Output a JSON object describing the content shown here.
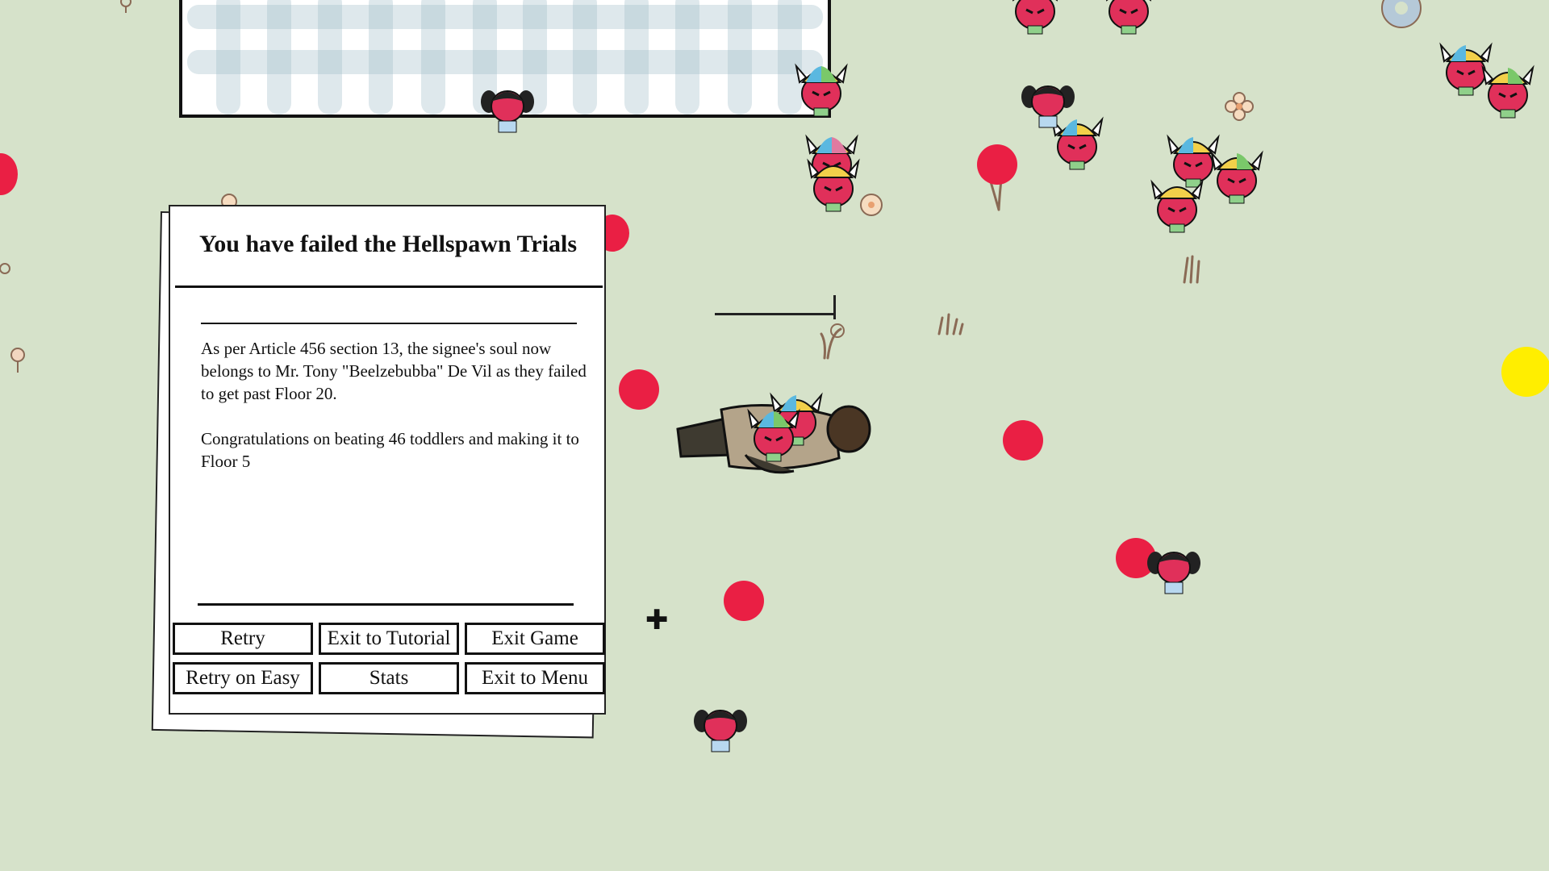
{
  "dialog": {
    "title": "You have failed the Hellspawn Trials",
    "paragraph_1": "As per Article 456 section 13, the signee's soul now belongs to Mr. Tony \"Beelzebubba\" De Vil as they failed to get past Floor 20.",
    "paragraph_2": "Congratulations on beating 46 toddlers and making it to Floor 5"
  },
  "buttons": {
    "retry": "Retry",
    "exit_to_tutorial": "Exit to Tutorial",
    "exit_game": "Exit Game",
    "retry_on_easy": "Retry on Easy",
    "stats": "Stats",
    "exit_to_menu": "Exit to Menu"
  },
  "hud": {
    "crosshair_glyph": "✚"
  },
  "colors": {
    "background": "#d6e2ca",
    "enemy_orb": "#ea1f44",
    "pickup_orb": "#ffee00",
    "demon_skin": "#e0305a"
  }
}
